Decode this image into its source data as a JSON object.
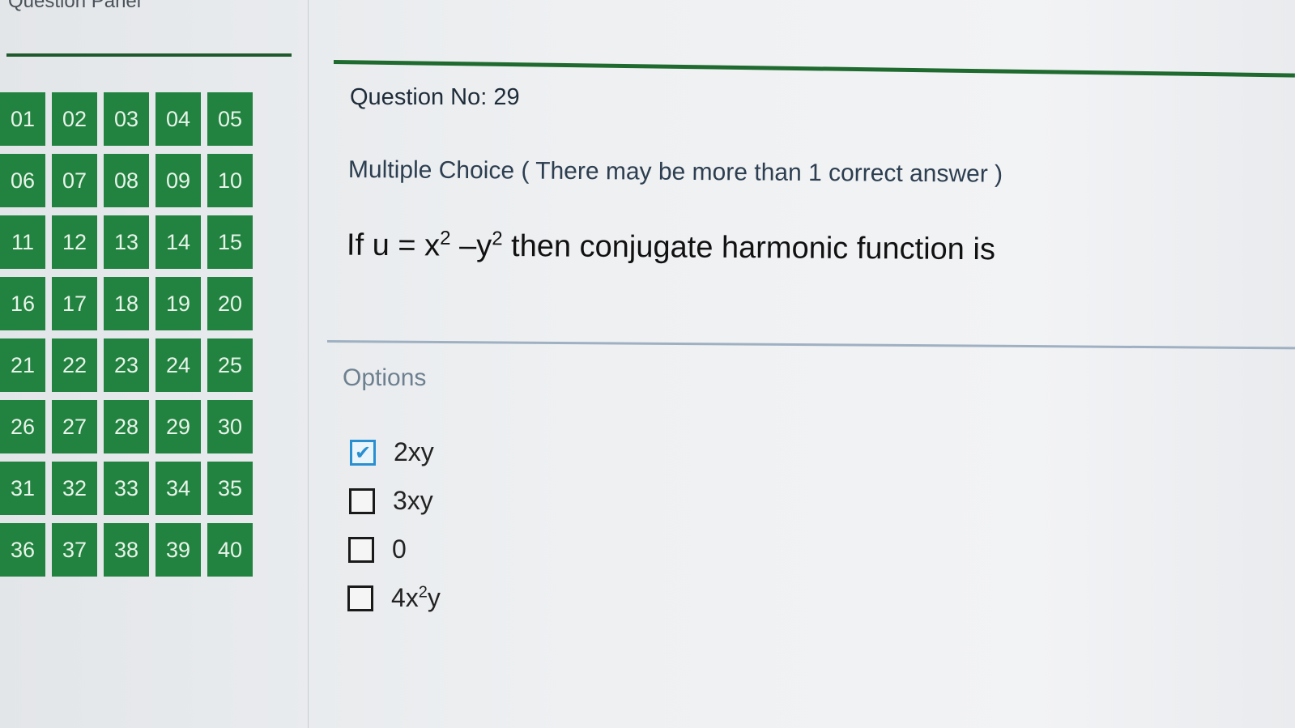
{
  "panel": {
    "title": "Question Panel",
    "questions": [
      "01",
      "02",
      "03",
      "04",
      "05",
      "06",
      "07",
      "08",
      "09",
      "10",
      "11",
      "12",
      "13",
      "14",
      "15",
      "16",
      "17",
      "18",
      "19",
      "20",
      "21",
      "22",
      "23",
      "24",
      "25",
      "26",
      "27",
      "28",
      "29",
      "30",
      "31",
      "32",
      "33",
      "34",
      "35",
      "36",
      "37",
      "38",
      "39",
      "40"
    ]
  },
  "question": {
    "number_label": "Question No: 29",
    "type_label": "Multiple Choice ( There may be more than 1 correct answer )",
    "text_prefix": "If u = x",
    "text_exp1": "2",
    "text_mid": " –y",
    "text_exp2": "2",
    "text_suffix": " then conjugate harmonic function is"
  },
  "options": {
    "label": "Options",
    "items": [
      {
        "text": "2xy",
        "checked": true
      },
      {
        "text": "3xy",
        "checked": false
      },
      {
        "text": "0",
        "checked": false
      },
      {
        "text": "4x",
        "sup": "2",
        "after": "y",
        "checked": false
      }
    ]
  },
  "colors": {
    "question_button_bg": "#21833f",
    "checked_accent": "#2a8fd0",
    "panel_rule": "#1f5a2c"
  }
}
